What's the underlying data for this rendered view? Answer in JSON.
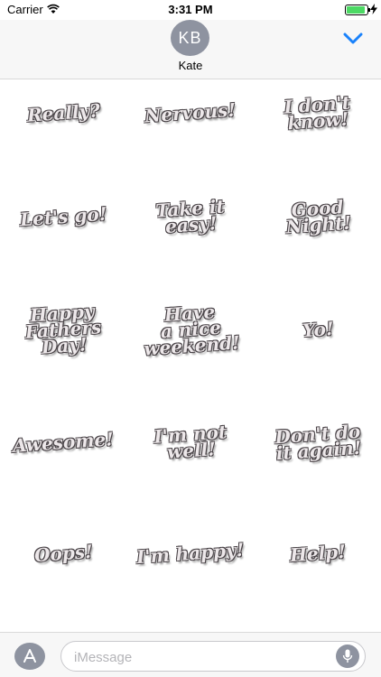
{
  "status_bar": {
    "carrier": "Carrier",
    "time": "3:31 PM",
    "battery_color": "#4cd964"
  },
  "header": {
    "avatar_initials": "KB",
    "contact_name": "Kate",
    "collapse_icon": "chevron-down-icon",
    "accent_color": "#1a82fb"
  },
  "stickers": [
    {
      "text": "Really?"
    },
    {
      "text": "Nervous!"
    },
    {
      "text": "I don't\nknow!"
    },
    {
      "text": "Let's go!"
    },
    {
      "text": "Take it\neasy!"
    },
    {
      "text": "Good\nNight!"
    },
    {
      "text": "Happy\nFathers Day!"
    },
    {
      "text": "Have\na nice\nweekend!"
    },
    {
      "text": "Yo!"
    },
    {
      "text": "Awesome!"
    },
    {
      "text": "I'm not\nwell!"
    },
    {
      "text": "Don't do\nit again!"
    },
    {
      "text": "Oops!"
    },
    {
      "text": "I'm happy!"
    },
    {
      "text": "Help!"
    }
  ],
  "input_bar": {
    "placeholder": "iMessage",
    "left_icon": "app-store-icon",
    "right_icon": "microphone-icon"
  }
}
